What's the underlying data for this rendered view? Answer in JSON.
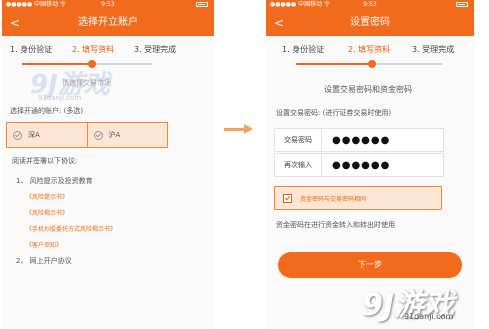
{
  "left": {
    "status": {
      "carrier": "●●●●● 中国移动 令",
      "time": "9:53"
    },
    "nav": {
      "back": "<",
      "title": "选择开立账户"
    },
    "steps": {
      "s1": "1. 身份验证",
      "s2": "2. 填写资料",
      "s3": "3. 受理完成"
    },
    "ghost_text": "请选择交易市场",
    "select_label": "选择开通的账户:  (多选)",
    "markets": {
      "sz": "深A",
      "sh": "沪A"
    },
    "protocol_intro": "阅读并签署以下协议:",
    "section1": "1、 风险提示及投资教育",
    "docs": [
      "《风险提示书》",
      "《风险揭示书》",
      "《手机炒股委托方式风险揭示书》",
      "《客户须知》"
    ],
    "section2": "2、 网上开户协议"
  },
  "right": {
    "status": {
      "carrier": "●●●●● 中国移动 令",
      "time": "9:53"
    },
    "nav": {
      "back": "<",
      "title": "设置密码"
    },
    "steps": {
      "s1": "1. 身份验证",
      "s2": "2. 填写资料",
      "s3": "3. 受理完成"
    },
    "heading": "设置交易密码和资金密码",
    "trade_hint": "设置交易密码: (进行证券交易时使用)",
    "fields": {
      "trade_label": "交易密码",
      "trade_value": "●●●●●●",
      "repeat_label": "再次输入",
      "repeat_value": "●●●●●●"
    },
    "same_option": "资金密码与交易密码相同",
    "fund_hint": "资金密码在进行资金转入和转出时使用",
    "next_button": "下一步"
  },
  "watermark": {
    "logo": "9J游戏",
    "url": "91danji.com"
  },
  "colors": {
    "accent": "#f26a1b",
    "highlight_bg": "#fde6d4",
    "link": "#e66a1a"
  },
  "icons": {
    "arrow": "right-arrow-icon",
    "check": "checkmark-icon"
  }
}
